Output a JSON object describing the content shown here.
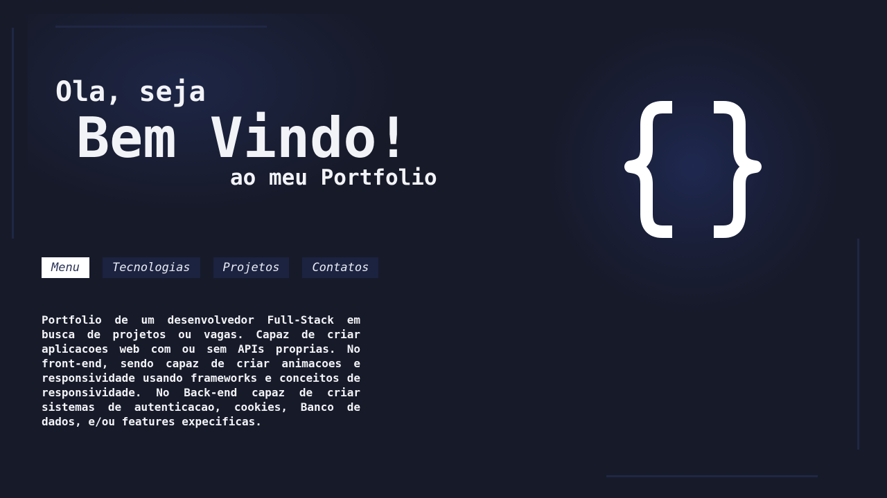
{
  "hero": {
    "greeting_line1": "Ola, seja",
    "greeting_line2": "Bem Vindo!",
    "greeting_line3": "ao meu Portfolio",
    "logo_icon": "curly-braces-icon"
  },
  "nav": {
    "items": [
      {
        "label": "Menu",
        "active": true
      },
      {
        "label": "Tecnologias",
        "active": false
      },
      {
        "label": "Projetos",
        "active": false
      },
      {
        "label": "Contatos",
        "active": false
      }
    ]
  },
  "about": {
    "description": "Portfolio de um desenvolvedor Full-Stack em busca de projetos ou vagas. Capaz de criar aplicacoes web com ou sem APIs proprias. No front-end, sendo capaz de criar animacoes e responsividade usando frameworks e conceitos de responsividade. No Back-end capaz de criar sistemas de autenticacao, cookies, Banco de dados, e/ou features expecificas."
  },
  "colors": {
    "background": "#171a29",
    "accent": "#1c2340",
    "text": "#f2f3f7",
    "active_nav_text": "#2a3356"
  }
}
